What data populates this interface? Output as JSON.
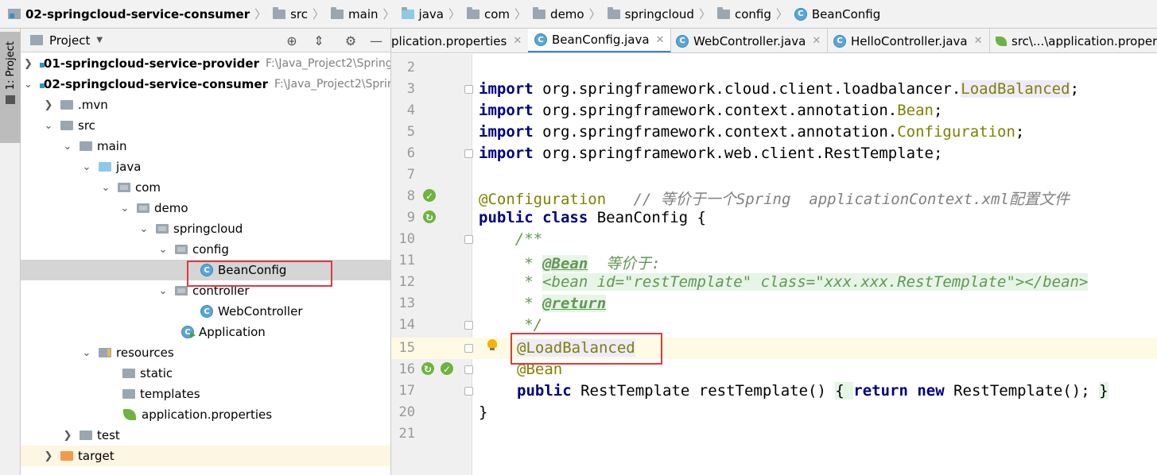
{
  "breadcrumb": {
    "items": [
      "02-springcloud-service-consumer",
      "src",
      "main",
      "java",
      "com",
      "demo",
      "springcloud",
      "config",
      "BeanConfig"
    ]
  },
  "toolstrip": {
    "project_tab": "1: Project"
  },
  "project_panel": {
    "title": "Project",
    "tree": [
      {
        "label": "01-springcloud-service-provider",
        "path": "F:\\Java_Project2\\Spring"
      },
      {
        "label": "02-springcloud-service-consumer",
        "path": "F:\\Java_Project2\\Sprin"
      },
      {
        "label": ".mvn"
      },
      {
        "label": "src"
      },
      {
        "label": "main"
      },
      {
        "label": "java"
      },
      {
        "label": "com"
      },
      {
        "label": "demo"
      },
      {
        "label": "springcloud"
      },
      {
        "label": "config"
      },
      {
        "label": "BeanConfig"
      },
      {
        "label": "controller"
      },
      {
        "label": "WebController"
      },
      {
        "label": "Application"
      },
      {
        "label": "resources"
      },
      {
        "label": "static"
      },
      {
        "label": "templates"
      },
      {
        "label": "application.properties"
      },
      {
        "label": "test"
      },
      {
        "label": "target"
      }
    ]
  },
  "tabs": [
    {
      "label": "plication.properties"
    },
    {
      "label": "BeanConfig.java"
    },
    {
      "label": "WebController.java"
    },
    {
      "label": "HelloController.java"
    },
    {
      "label": "src\\...\\application.proper"
    }
  ],
  "editor": {
    "line_numbers": [
      "2",
      "3",
      "4",
      "5",
      "6",
      "7",
      "8",
      "9",
      "10",
      "11",
      "12",
      "13",
      "14",
      "15",
      "16",
      "17",
      "20",
      "21"
    ],
    "code": {
      "l3_kw": "import",
      "l3_pkg": " org.springframework.cloud.client.loadbalancer.",
      "l3_cls": "LoadBalanced",
      "l4_kw": "import",
      "l4_pkg": " org.springframework.context.annotation.",
      "l4_cls": "Bean",
      "l5_kw": "import",
      "l5_pkg": " org.springframework.context.annotation.",
      "l5_cls": "Configuration",
      "l6_kw": "import",
      "l6_pkg": " org.springframework.web.client.RestTemplate;",
      "l8_ann": "@Configuration",
      "l8_cmt": "   // 等价于一个Spring  applicationContext.xml配置文件",
      "l9_kw": "public class",
      "l9_rest": " BeanConfig {",
      "l10": "    /**",
      "l11_pre": "     * ",
      "l11_tag": "@Bean",
      "l11_txt": "  等价于:",
      "l12_pre": "     * ",
      "l12_txt": "<bean id=\"restTemplate\" class=\"xxx.xxx.RestTemplate\"></bean>",
      "l13_pre": "     * ",
      "l13_tag": "@return",
      "l14": "     */",
      "l15_ann": "@LoadBalanced",
      "l16_ann": "@Bean",
      "l17_kw": "public",
      "l17_a": " RestTemplate restTemplate() ",
      "l17_b": "{ ",
      "l17_kw2": "return new",
      "l17_c": " RestTemplate(); ",
      "l17_d": "}",
      "l20": "}"
    }
  }
}
